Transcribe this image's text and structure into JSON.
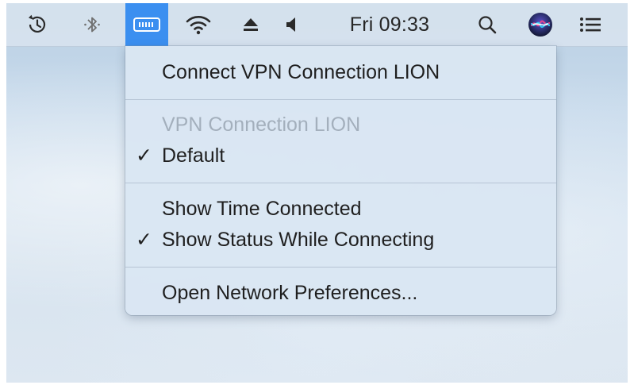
{
  "menubar": {
    "icons": [
      {
        "name": "time-machine-icon"
      },
      {
        "name": "bluetooth-icon"
      },
      {
        "name": "vpn-status-icon",
        "active": true
      },
      {
        "name": "wifi-icon"
      },
      {
        "name": "eject-icon"
      },
      {
        "name": "volume-icon"
      },
      {
        "name": "spotlight-search-icon"
      },
      {
        "name": "siri-icon"
      },
      {
        "name": "notification-center-icon"
      }
    ],
    "clock": "Fri 09:33",
    "accent_color": "#3b8ff0"
  },
  "vpn_menu": {
    "connect": "Connect VPN Connection LION",
    "section_title": "VPN Connection LION",
    "default_item": {
      "label": "Default",
      "checked": true,
      "check": "✓"
    },
    "show_time": {
      "label": "Show Time Connected",
      "checked": false
    },
    "show_status": {
      "label": "Show Status While Connecting",
      "checked": true,
      "check": "✓"
    },
    "open_prefs": "Open Network Preferences..."
  }
}
